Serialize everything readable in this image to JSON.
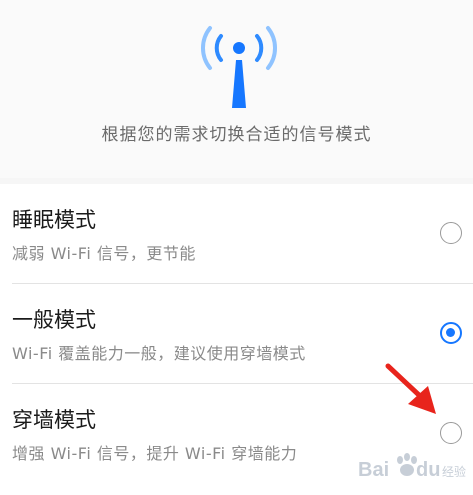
{
  "header": {
    "description": "根据您的需求切换合适的信号模式",
    "icon": "wifi-signal-tower-icon",
    "accent_color": "#1677ff"
  },
  "modes": [
    {
      "title": "睡眠模式",
      "subtitle": "减弱 Wi-Fi 信号，更节能",
      "selected": false
    },
    {
      "title": "一般模式",
      "subtitle": "Wi-Fi 覆盖能力一般，建议使用穿墙模式",
      "selected": true
    },
    {
      "title": "穿墙模式",
      "subtitle": "增强 Wi-Fi 信号，提升 Wi-Fi 穿墙能力",
      "selected": false
    }
  ],
  "annotation": {
    "icon": "red-arrow-icon",
    "color": "#e8241c"
  },
  "watermark": {
    "text": "Bai du 经验",
    "icon": "baidu-paw-icon"
  }
}
